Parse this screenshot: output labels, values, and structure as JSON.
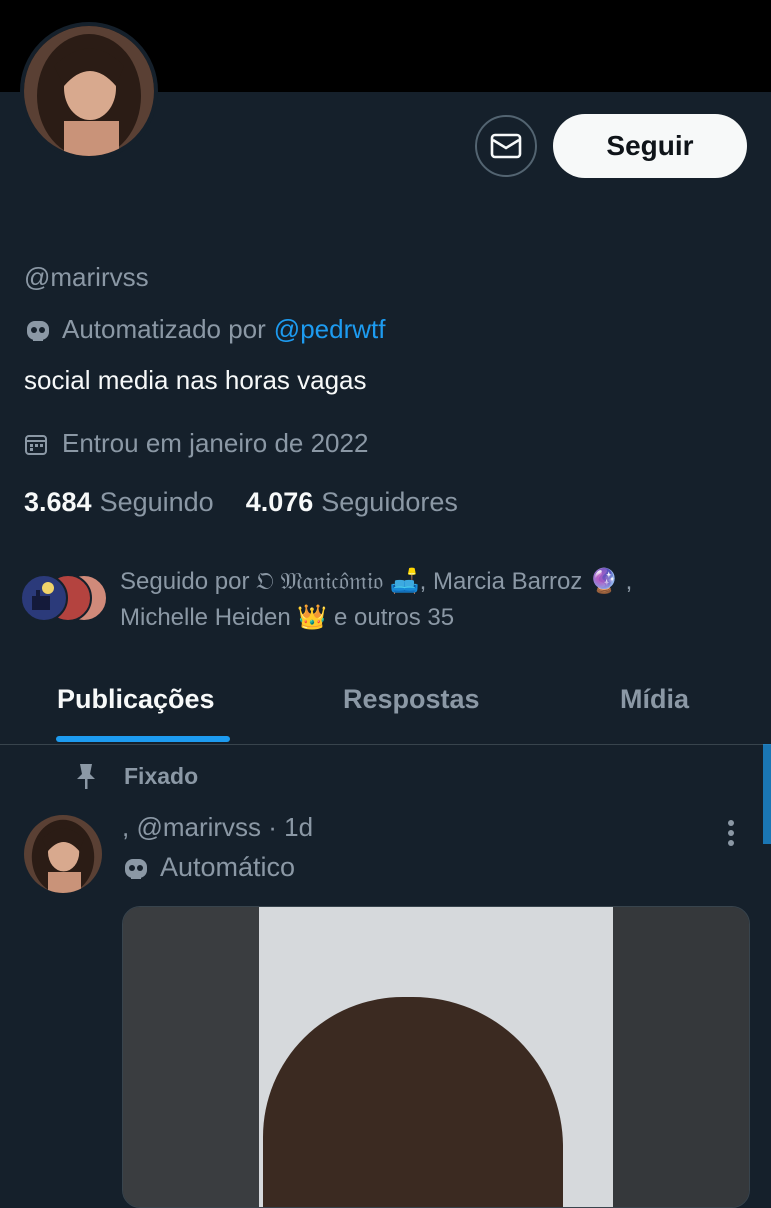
{
  "profile": {
    "handle": "@marirvss",
    "automated_prefix": "Automatizado por",
    "automated_by": "@pedrwtf",
    "bio": "social media nas horas vagas",
    "joined": "Entrou em janeiro de 2022",
    "following_count": "3.684",
    "following_label": "Seguindo",
    "followers_count": "4.076",
    "followers_label": "Seguidores"
  },
  "actions": {
    "follow_label": "Seguir",
    "message_icon": "envelope-icon"
  },
  "followed_by": {
    "line1_prefix": "Seguido por",
    "name1": "𝔒 𝔐𝔞𝔫𝔦𝔠𝔬̂𝔪𝔦𝔬 🛋️",
    "name2": ", Marcia Barroz 🔮 ,",
    "name3": "Michelle Heiden 👑",
    "suffix": "e outros 35"
  },
  "tabs": [
    {
      "label": "Publicações"
    },
    {
      "label": "Respostas"
    },
    {
      "label": "Mídia"
    }
  ],
  "post": {
    "pinned_label": "Fixado",
    "author": ", @marirvss",
    "time": "· 1d",
    "automated_label": "Automático"
  },
  "colors": {
    "background": "#15202b",
    "accent": "#1d9bf0",
    "muted": "#8b98a5"
  }
}
